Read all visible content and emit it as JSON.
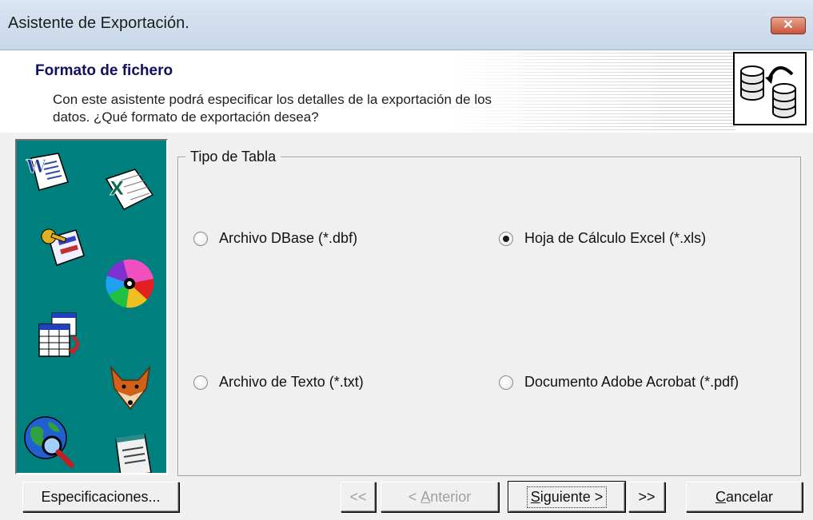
{
  "window": {
    "title": "Asistente de Exportación.",
    "close_label": "✕"
  },
  "header": {
    "title": "Formato de fichero",
    "desc_line1": "Con este asistente podrá especificar los detalles de la exportación de los",
    "desc_line2": "datos. ¿Qué formato de exportación desea?",
    "icon": "database-export-icon"
  },
  "side_panel": {
    "background": "#007f7f",
    "icons": [
      "word-document-icon",
      "excel-document-icon",
      "keys-card-icon",
      "color-disc-icon",
      "table-grid-icon",
      "foxpro-fox-icon",
      "globe-search-icon",
      "notepad-icon"
    ]
  },
  "group": {
    "legend": "Tipo de Tabla",
    "options": [
      {
        "label": "Archivo DBase (*.dbf)",
        "selected": false
      },
      {
        "label": "Hoja de Cálculo Excel (*.xls)",
        "selected": true
      },
      {
        "label": "Archivo de Texto (*.txt)",
        "selected": false
      },
      {
        "label": "Documento Adobe Acrobat (*.pdf)",
        "selected": false
      }
    ]
  },
  "buttons": {
    "specs": "Especificaciones...",
    "first": "<<",
    "prev_rest": "nterior",
    "prev_prefix": "< ",
    "prev_ul": "A",
    "next_ul": "S",
    "next_rest": "iguiente >",
    "last": ">>",
    "cancel_ul": "C",
    "cancel_rest": "ancelar"
  }
}
